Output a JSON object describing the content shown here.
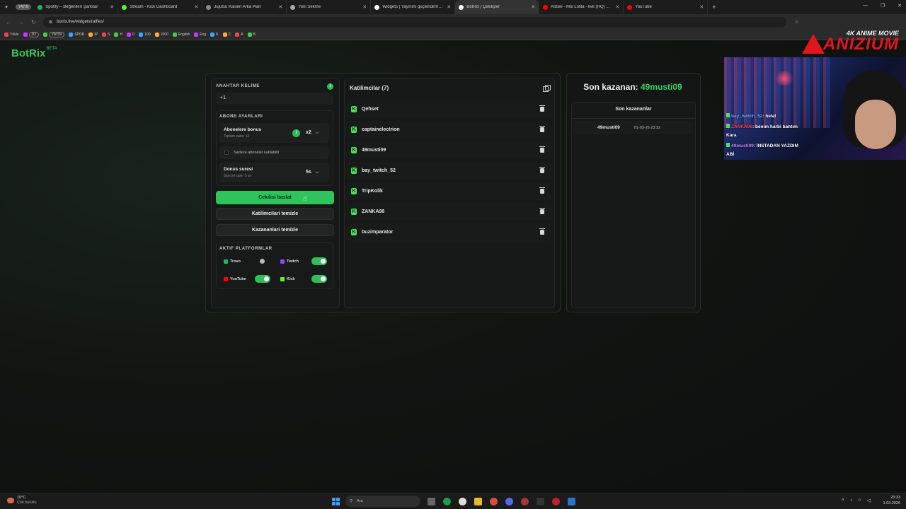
{
  "browser": {
    "group_label": "YAYIN",
    "tabs": [
      {
        "title": "Spotify – Beğenilen Şarkılar",
        "color": "#1db954",
        "active": false
      },
      {
        "title": "Stream - Kick Dashboard",
        "color": "#53fc18",
        "active": false
      },
      {
        "title": "Jujutsu Kaisen Arka Plan",
        "color": "#8a8a8a",
        "active": false
      },
      {
        "title": "Yeni Sekme",
        "color": "#aaaaaa",
        "active": false
      },
      {
        "title": "Widgets | Yayınını güçlendirme...",
        "color": "#ffffff",
        "active": false
      },
      {
        "title": "BotRix | Çekilişler",
        "color": "#ffffff",
        "active": true
      },
      {
        "title": "Alizee - Moi Lolita - live (HQ) ...",
        "color": "#ff0000",
        "active": false
      },
      {
        "title": "YouTube",
        "color": "#ff0000",
        "active": false
      }
    ],
    "url": "botrix.live/widgets/raffles/",
    "bookmarks": [
      "Yükle",
      "3D",
      "YAYIN",
      "SPOR",
      "IP",
      "S",
      "H",
      "P",
      "100",
      "1000",
      "English",
      "Eng",
      "K",
      "C",
      "A",
      "B"
    ]
  },
  "app": {
    "logo": "BotRix",
    "logo_badge": "BETA",
    "accent": "#2fc35d"
  },
  "settings": {
    "keyword_title": "ANAHTAR KELİME",
    "keyword_value": "+1",
    "subscriber_title": "ABONE AYARLARI",
    "sub_bonus_label": "Abonelere bonus",
    "sub_bonus_sub": "Toplam sans: x2",
    "sub_bonus_value": "x2",
    "sub_only_label": "Sadece aboneler katilabilir",
    "bonus_time_label": "Donus suresi",
    "bonus_time_sub": "Guncel sure: 5 sn",
    "bonus_time_value": "5s",
    "start_button": "Cekilisi baslat",
    "clear_participants": "Katilimcilari temizle",
    "clear_winners": "Kazananlari temizle",
    "platforms_title": "AKTIF PLATFORMLAR",
    "platforms": [
      {
        "name": "Trovo",
        "on": false,
        "color": "#1bb86b"
      },
      {
        "name": "Twitch",
        "on": true,
        "color": "#9146ff"
      },
      {
        "name": "YouTube",
        "on": true,
        "color": "#ff0000"
      },
      {
        "name": "Kick",
        "on": true,
        "color": "#53fc18"
      }
    ]
  },
  "participants": {
    "title": "Katilimcilar (7)",
    "items": [
      "Qehset",
      "captainelectrion",
      "49musti09",
      "bay_twitch_52",
      "TripKolik",
      "ZANKA96",
      "buzimparator"
    ]
  },
  "winners": {
    "title_prefix": "Son kazanan:",
    "title_name": "49musti09",
    "list_title": "Son kazananlar",
    "items": [
      {
        "name": "49musti09",
        "time": "01-03-26 23:32"
      }
    ]
  },
  "overlay": {
    "brand_top": "4K ANIME MOVIE",
    "brand_main": "ANIZIUM",
    "chat": [
      {
        "user": "bay_twitch_52",
        "msg": ": helal",
        "user_color": "#6ab0ff"
      },
      {
        "user": "ZANKA96",
        "msg": ": benim harbi bahtım",
        "cont": "Kara",
        "user_color": "#ff4040"
      },
      {
        "user": "49musti09",
        "msg": ": İNSTADAN YAZDIM",
        "cont": "ABİ",
        "user_color": "#c888ff"
      }
    ]
  },
  "taskbar": {
    "temp": "10°C",
    "weather": "Çok bulutlu",
    "search": "Ara",
    "time": "23:33",
    "date": "1.03.2026"
  }
}
